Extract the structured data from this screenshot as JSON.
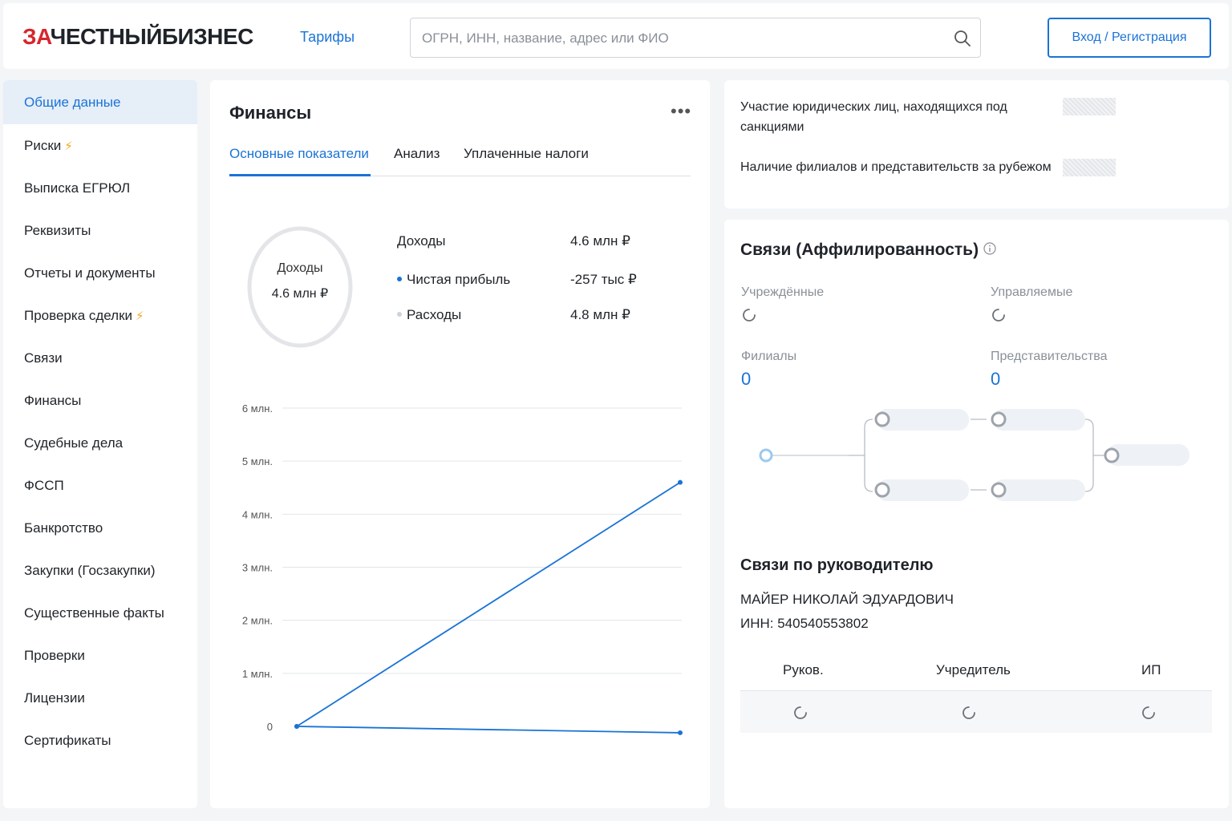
{
  "header": {
    "logo_red": "ЗА",
    "logo_dark": "ЧЕСТНЫЙБИЗНЕС",
    "tariffs": "Тарифы",
    "search_placeholder": "ОГРН, ИНН, название, адрес или ФИО",
    "login": "Вход / Регистрация"
  },
  "sidebar": {
    "items": [
      {
        "label": "Общие данные",
        "active": true
      },
      {
        "label": "Риски",
        "bolt": true
      },
      {
        "label": "Выписка ЕГРЮЛ"
      },
      {
        "label": "Реквизиты"
      },
      {
        "label": "Отчеты и документы"
      },
      {
        "label": "Проверка сделки",
        "bolt": true
      },
      {
        "label": "Связи"
      },
      {
        "label": "Финансы"
      },
      {
        "label": "Судебные дела"
      },
      {
        "label": "ФССП"
      },
      {
        "label": "Банкротство"
      },
      {
        "label": "Закупки (Госзакупки)"
      },
      {
        "label": "Существенные факты"
      },
      {
        "label": "Проверки"
      },
      {
        "label": "Лицензии"
      },
      {
        "label": "Сертификаты"
      }
    ]
  },
  "finance": {
    "title": "Финансы",
    "more": "•••",
    "tabs": [
      "Основные показатели",
      "Анализ",
      "Уплаченные налоги"
    ],
    "donut": {
      "label": "Доходы",
      "value": "4.6 млн ₽"
    },
    "metrics": [
      {
        "label": "Доходы",
        "value": "4.6 млн ₽"
      },
      {
        "label": "Чистая прибыль",
        "value": "-257 тыс ₽"
      },
      {
        "label": "Расходы",
        "value": "4.8 млн ₽"
      }
    ],
    "colors": {
      "accent": "#1a73d6",
      "profit_dot": "#1a73d6",
      "expense_dot": "#c9d3de"
    }
  },
  "chart_data": {
    "type": "line",
    "y_ticks": [
      "0",
      "1 млн.",
      "2 млн.",
      "3 млн.",
      "4 млн.",
      "5 млн.",
      "6 млн."
    ],
    "ylim": [
      0,
      6
    ],
    "x": [
      0,
      1
    ],
    "series": [
      {
        "values": [
          0,
          4.6
        ]
      },
      {
        "values": [
          0,
          -0.12
        ]
      }
    ]
  },
  "sanctions": {
    "rows": [
      "Участие юридических лиц, находящихся под санкциями",
      "Наличие филиалов и представительств за рубежом"
    ]
  },
  "relations": {
    "title": "Связи (Аффилированность)",
    "founded": "Учреждённые",
    "managed": "Управляемые",
    "branches": "Филиалы",
    "branches_count": "0",
    "reps": "Представительства",
    "reps_count": "0"
  },
  "leader": {
    "title": "Связи по руководителю",
    "name": "МАЙЕР НИКОЛАЙ ЭДУАРДОВИЧ",
    "inn": "ИНН: 540540553802",
    "tabs": [
      "Руков.",
      "Учредитель",
      "ИП"
    ]
  }
}
